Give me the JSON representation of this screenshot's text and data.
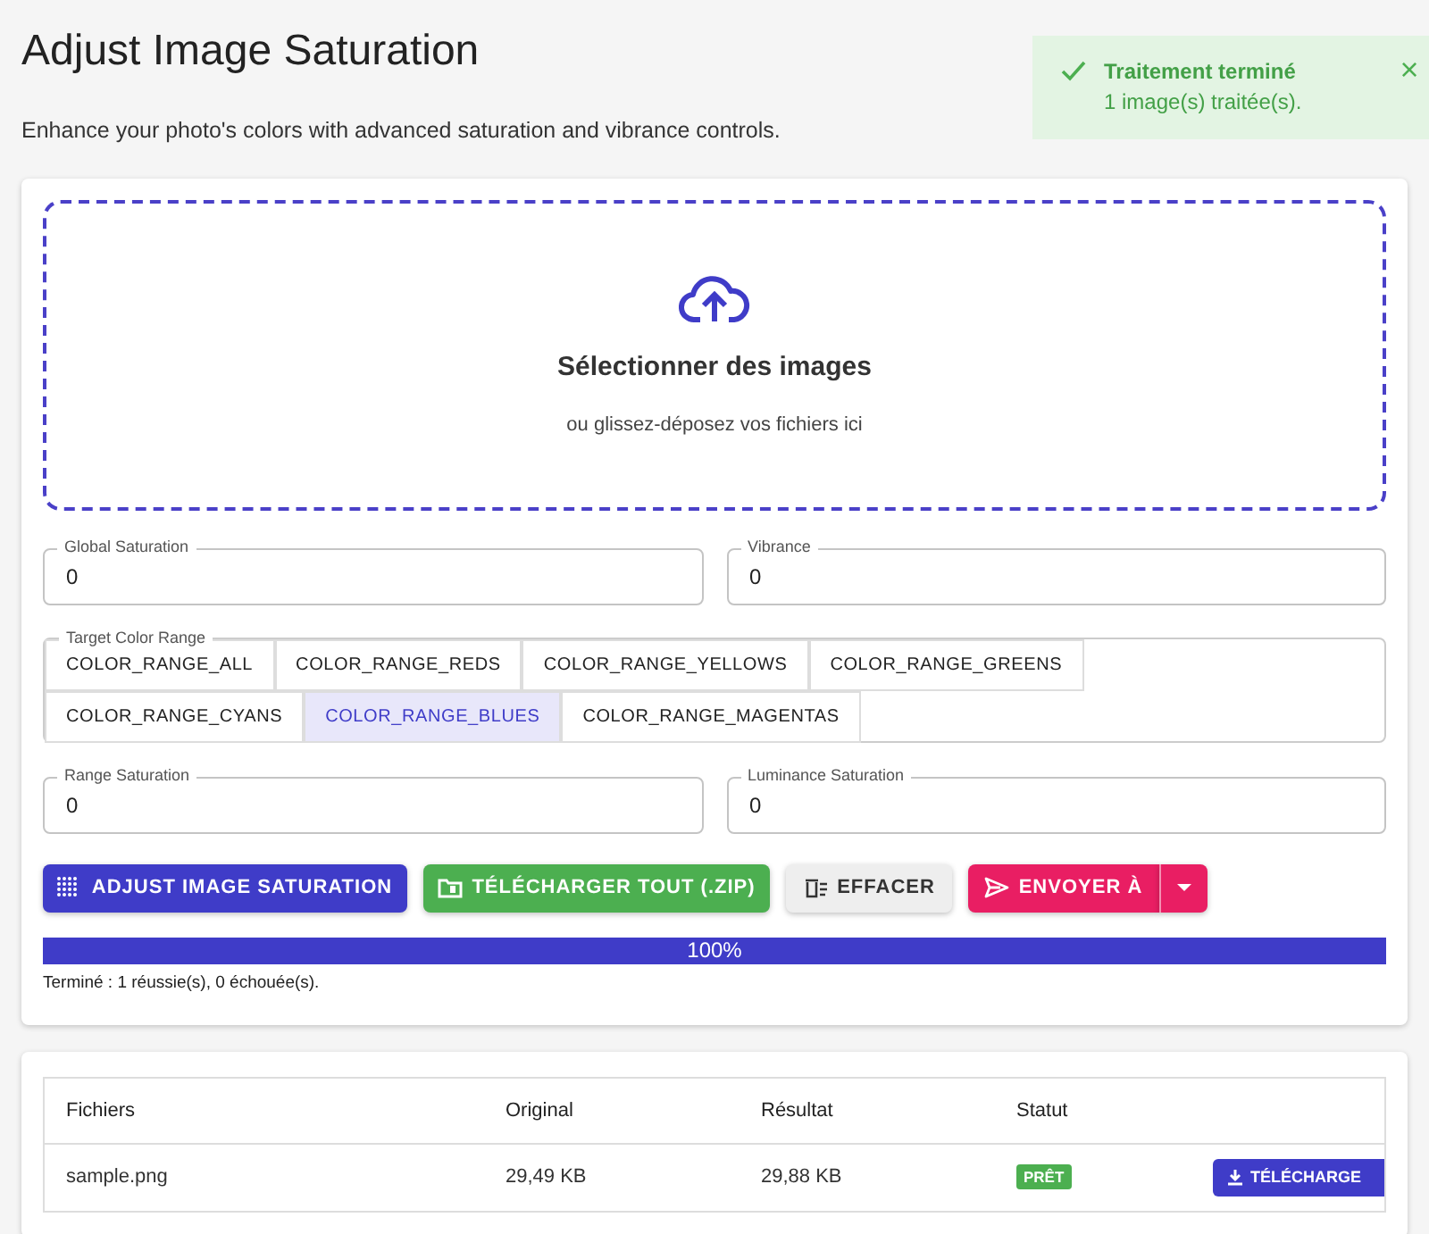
{
  "title": "Adjust Image Saturation",
  "subtitle": "Enhance your photo's colors with advanced saturation and vibrance controls.",
  "toast": {
    "title": "Traitement terminé",
    "message": "1 image(s) traitée(s).",
    "close": "×"
  },
  "dropzone": {
    "title": "Sélectionner des images",
    "hint": "ou glissez-déposez vos fichiers ici"
  },
  "fields_top": [
    {
      "label": "Global Saturation",
      "value": "0"
    },
    {
      "label": "Vibrance",
      "value": "0"
    }
  ],
  "color_range": {
    "label": "Target Color Range",
    "options": [
      {
        "label": "COLOR_RANGE_ALL",
        "selected": false
      },
      {
        "label": "COLOR_RANGE_REDS",
        "selected": false
      },
      {
        "label": "COLOR_RANGE_YELLOWS",
        "selected": false
      },
      {
        "label": "COLOR_RANGE_GREENS",
        "selected": false
      },
      {
        "label": "COLOR_RANGE_CYANS",
        "selected": false
      },
      {
        "label": "COLOR_RANGE_BLUES",
        "selected": true
      },
      {
        "label": "COLOR_RANGE_MAGENTAS",
        "selected": false
      }
    ]
  },
  "fields_bottom": [
    {
      "label": "Range Saturation",
      "value": "0"
    },
    {
      "label": "Luminance Saturation",
      "value": "0"
    }
  ],
  "buttons": [
    {
      "kind": "adjust",
      "label": "ADJUST IMAGE SATURATION"
    },
    {
      "kind": "zip",
      "label": "TÉLÉCHARGER TOUT (.ZIP)"
    },
    {
      "kind": "clear",
      "label": "EFFACER"
    },
    {
      "kind": "send",
      "label": "ENVOYER À"
    }
  ],
  "progress": {
    "level": 1,
    "reading": "100%"
  },
  "status": "Terminé : 1 réussie(s), 0 échouée(s).",
  "table": {
    "columns": [
      "Fichiers",
      "Original",
      "Résultat",
      "Statut"
    ],
    "rows": [
      {
        "file": "sample.png",
        "original": "29,49 KB",
        "result": "29,88 KB",
        "status": "PRÊT",
        "action": "TÉLÉCHARGE"
      }
    ]
  }
}
